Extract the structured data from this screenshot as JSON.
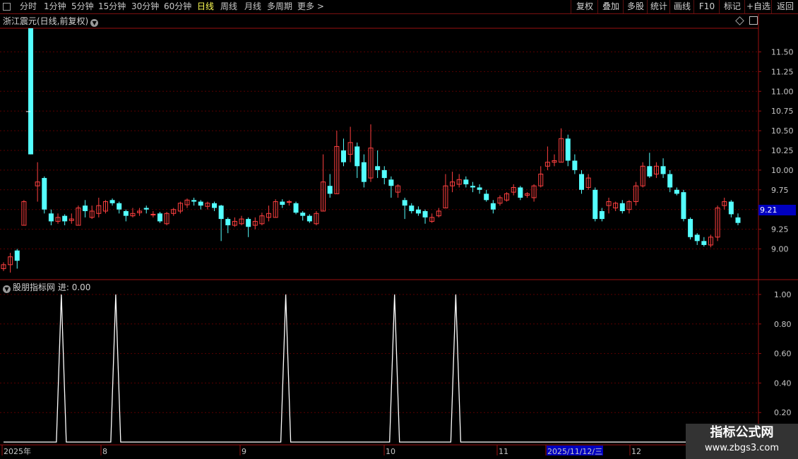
{
  "toolbar": {
    "left_items": [
      "分时",
      "1分钟",
      "5分钟",
      "15分钟",
      "30分钟",
      "60分钟",
      "日线",
      "周线",
      "月线",
      "多周期",
      "更多 >"
    ],
    "active_index": 6,
    "right_buttons": [
      "复权",
      "叠加",
      "多股",
      "统计",
      "画线",
      "F10",
      "标记",
      "+自选",
      "返回"
    ]
  },
  "main_chart": {
    "title": "浙江震元(日线,前复权)",
    "y_ticks": [
      "11.50",
      "11.25",
      "11.00",
      "10.75",
      "10.50",
      "10.25",
      "10.00",
      "9.75",
      "9.50",
      "9.25",
      "9.00"
    ],
    "current_price": "9.21",
    "colors": {
      "up": "#ff4040",
      "down": "#54ffff"
    }
  },
  "indicator": {
    "title": "股朋指标网",
    "label": "进: 0.00",
    "y_ticks": [
      "1.00",
      "0.80",
      "0.60",
      "0.40",
      "0.20"
    ],
    "spikes": [
      8,
      16,
      41,
      57,
      66
    ]
  },
  "x_axis": {
    "labels": [
      "2025年",
      "8",
      "9",
      "10",
      "11",
      "2025/11/12/三",
      "12"
    ]
  },
  "chart_data": {
    "type": "candlestick",
    "ylim": [
      8.7,
      11.8
    ],
    "candles": [
      [
        8.75,
        8.8,
        8.72,
        8.83
      ],
      [
        8.8,
        8.9,
        8.7,
        8.95
      ],
      [
        8.98,
        8.85,
        8.75,
        9.0
      ],
      [
        9.3,
        9.6,
        9.3,
        9.62
      ],
      [
        11.8,
        10.2,
        10.2,
        11.8
      ],
      [
        9.8,
        9.85,
        9.6,
        10.1
      ],
      [
        9.9,
        9.5,
        9.45,
        9.92
      ],
      [
        9.45,
        9.35,
        9.3,
        9.5
      ],
      [
        9.35,
        9.4,
        9.32,
        9.45
      ],
      [
        9.42,
        9.35,
        9.3,
        9.44
      ],
      [
        9.36,
        9.38,
        9.32,
        9.45
      ],
      [
        9.3,
        9.52,
        9.3,
        9.55
      ],
      [
        9.55,
        9.48,
        9.4,
        9.62
      ],
      [
        9.4,
        9.48,
        9.38,
        9.55
      ],
      [
        9.45,
        9.55,
        9.4,
        9.65
      ],
      [
        9.48,
        9.6,
        9.45,
        9.62
      ],
      [
        9.62,
        9.58,
        9.55,
        9.64
      ],
      [
        9.58,
        9.5,
        9.45,
        9.6
      ],
      [
        9.48,
        9.42,
        9.35,
        9.5
      ],
      [
        9.42,
        9.45,
        9.4,
        9.52
      ],
      [
        9.46,
        9.48,
        9.42,
        9.52
      ],
      [
        9.52,
        9.5,
        9.45,
        9.55
      ],
      [
        9.44,
        9.44,
        9.4,
        9.48
      ],
      [
        9.45,
        9.35,
        9.33,
        9.47
      ],
      [
        9.32,
        9.45,
        9.3,
        9.47
      ],
      [
        9.45,
        9.5,
        9.42,
        9.52
      ],
      [
        9.48,
        9.58,
        9.45,
        9.6
      ],
      [
        9.56,
        9.62,
        9.52,
        9.64
      ],
      [
        9.62,
        9.6,
        9.55,
        9.65
      ],
      [
        9.6,
        9.55,
        9.5,
        9.62
      ],
      [
        9.54,
        9.58,
        9.5,
        9.6
      ],
      [
        9.58,
        9.52,
        9.48,
        9.6
      ],
      [
        9.55,
        9.38,
        9.1,
        9.56
      ],
      [
        9.38,
        9.3,
        9.2,
        9.4
      ],
      [
        9.3,
        9.35,
        9.28,
        9.4
      ],
      [
        9.32,
        9.38,
        9.3,
        9.42
      ],
      [
        9.38,
        9.28,
        9.15,
        9.4
      ],
      [
        9.3,
        9.35,
        9.25,
        9.4
      ],
      [
        9.32,
        9.42,
        9.3,
        9.46
      ],
      [
        9.4,
        9.45,
        9.35,
        9.55
      ],
      [
        9.4,
        9.6,
        9.4,
        9.63
      ],
      [
        9.6,
        9.56,
        9.52,
        9.63
      ],
      [
        9.6,
        9.6,
        9.55,
        9.62
      ],
      [
        9.58,
        9.46,
        9.44,
        9.6
      ],
      [
        9.46,
        9.42,
        9.36,
        9.48
      ],
      [
        9.42,
        9.35,
        9.33,
        9.44
      ],
      [
        9.32,
        9.45,
        9.3,
        9.48
      ],
      [
        9.48,
        9.85,
        9.48,
        10.2
      ],
      [
        9.8,
        9.7,
        9.65,
        9.95
      ],
      [
        9.7,
        10.3,
        9.7,
        10.5
      ],
      [
        10.25,
        10.1,
        10.05,
        10.4
      ],
      [
        10.2,
        10.35,
        10.1,
        10.55
      ],
      [
        10.3,
        10.05,
        9.9,
        10.35
      ],
      [
        10.1,
        9.85,
        9.78,
        10.2
      ],
      [
        9.9,
        10.28,
        9.85,
        10.58
      ],
      [
        10.05,
        10.0,
        9.9,
        10.25
      ],
      [
        10.0,
        9.9,
        9.82,
        10.05
      ],
      [
        9.88,
        9.8,
        9.65,
        9.92
      ],
      [
        9.72,
        9.8,
        9.65,
        9.82
      ],
      [
        9.62,
        9.55,
        9.38,
        9.65
      ],
      [
        9.55,
        9.48,
        9.45,
        9.58
      ],
      [
        9.5,
        9.45,
        9.42,
        9.54
      ],
      [
        9.48,
        9.4,
        9.32,
        9.5
      ],
      [
        9.35,
        9.4,
        9.33,
        9.45
      ],
      [
        9.42,
        9.48,
        9.4,
        9.52
      ],
      [
        9.52,
        9.8,
        9.52,
        9.95
      ],
      [
        9.8,
        9.85,
        9.72,
        9.98
      ],
      [
        9.82,
        9.88,
        9.78,
        9.95
      ],
      [
        9.88,
        9.82,
        9.78,
        9.92
      ],
      [
        9.8,
        9.78,
        9.72,
        9.85
      ],
      [
        9.78,
        9.75,
        9.7,
        9.82
      ],
      [
        9.7,
        9.62,
        9.6,
        9.75
      ],
      [
        9.58,
        9.5,
        9.45,
        9.62
      ],
      [
        9.58,
        9.65,
        9.55,
        9.68
      ],
      [
        9.62,
        9.7,
        9.6,
        9.72
      ],
      [
        9.72,
        9.78,
        9.68,
        9.82
      ],
      [
        9.78,
        9.65,
        9.62,
        9.8
      ],
      [
        9.68,
        9.7,
        9.65,
        9.72
      ],
      [
        9.65,
        9.8,
        9.6,
        9.82
      ],
      [
        9.8,
        9.95,
        9.78,
        10.05
      ],
      [
        10.05,
        10.1,
        10.0,
        10.3
      ],
      [
        10.1,
        10.12,
        10.05,
        10.2
      ],
      [
        10.1,
        10.4,
        10.1,
        10.53
      ],
      [
        10.4,
        10.12,
        10.05,
        10.45
      ],
      [
        10.12,
        10.0,
        9.95,
        10.2
      ],
      [
        9.95,
        9.75,
        9.7,
        10.0
      ],
      [
        9.78,
        9.9,
        9.75,
        9.95
      ],
      [
        9.75,
        9.38,
        9.35,
        9.78
      ],
      [
        9.48,
        9.38,
        9.35,
        9.52
      ],
      [
        9.55,
        9.6,
        9.45,
        9.65
      ],
      [
        9.52,
        9.58,
        9.48,
        9.6
      ],
      [
        9.58,
        9.48,
        9.45,
        9.62
      ],
      [
        9.5,
        9.6,
        9.45,
        9.62
      ],
      [
        9.6,
        9.8,
        9.55,
        9.85
      ],
      [
        9.8,
        10.05,
        9.78,
        10.1
      ],
      [
        10.05,
        9.92,
        9.9,
        10.22
      ],
      [
        9.95,
        10.05,
        9.9,
        10.1
      ],
      [
        10.05,
        9.95,
        9.9,
        10.15
      ],
      [
        9.95,
        9.78,
        9.72,
        10.0
      ],
      [
        9.75,
        9.7,
        9.68,
        9.78
      ],
      [
        9.72,
        9.38,
        9.35,
        9.75
      ],
      [
        9.38,
        9.15,
        9.12,
        9.4
      ],
      [
        9.18,
        9.1,
        9.05,
        9.2
      ],
      [
        9.1,
        9.05,
        9.03,
        9.15
      ],
      [
        9.05,
        9.15,
        9.02,
        9.18
      ],
      [
        9.15,
        9.52,
        9.1,
        9.55
      ],
      [
        9.55,
        9.6,
        9.5,
        9.65
      ],
      [
        9.6,
        9.44,
        9.4,
        9.62
      ],
      [
        9.4,
        9.33,
        9.3,
        9.45
      ]
    ]
  }
}
